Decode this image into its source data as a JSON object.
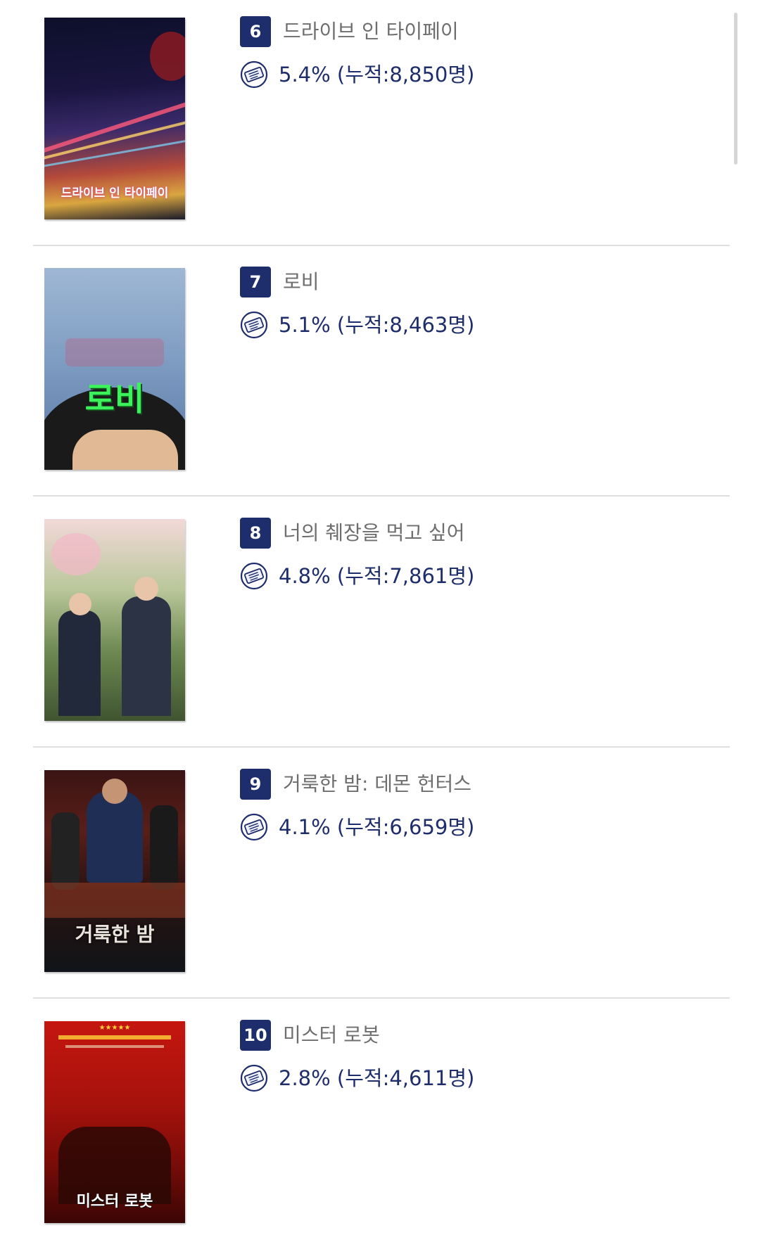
{
  "movies": [
    {
      "rank": "6",
      "title": "드라이브 인 타이페이",
      "stat": "5.4% (누적:8,850명)",
      "poster_text": "드라이브 인 타이페이"
    },
    {
      "rank": "7",
      "title": "로비",
      "stat": "5.1% (누적:8,463명)",
      "poster_text": "로비"
    },
    {
      "rank": "8",
      "title": "너의 췌장을 먹고 싶어",
      "stat": "4.8% (누적:7,861명)",
      "poster_text": ""
    },
    {
      "rank": "9",
      "title": "거룩한 밤: 데몬 헌터스",
      "stat": "4.1% (누적:6,659명)",
      "poster_text": "거룩한 밤"
    },
    {
      "rank": "10",
      "title": "미스터 로봇",
      "stat": "2.8% (누적:4,611명)",
      "poster_text": "미스터 로봇"
    }
  ],
  "colors": {
    "accent": "#1e2d6b",
    "title_text": "#6e6e6e",
    "divider": "#dedede"
  },
  "icons": {
    "ticket": "ticket-icon"
  }
}
